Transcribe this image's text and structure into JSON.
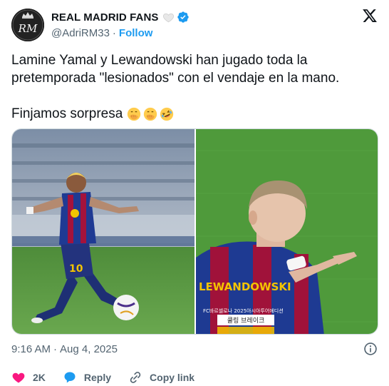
{
  "account": {
    "name": "REAL MADRID FANS",
    "handle": "@AdriRM33",
    "separator": "·",
    "follow_label": "Follow",
    "avatar_monogram": "RM",
    "icons": [
      "white-heart-icon",
      "verified-badge-icon"
    ]
  },
  "brand_icon": "x-logo-icon",
  "tweet": {
    "line1": "Lamine Yamal y Lewandowski han jugado toda la",
    "line2": "pretemporada \"lesionados\" con el vendaje en la mano.",
    "line3": "Finjamos sorpresa",
    "emojis": [
      "face-with-hand-over-mouth-icon",
      "face-with-hand-over-mouth-icon",
      "rolling-on-floor-laughing-icon"
    ]
  },
  "media": {
    "photos": [
      {
        "name": "photo-lamine-yamal",
        "jersey_number": "10"
      },
      {
        "name": "photo-lewandowski",
        "jersey_name": "LEWANDOWSKI",
        "caption_top": "FC바르셀로나 2025아시아투어에디션",
        "caption_bottom": "쿨링 브레이크"
      }
    ]
  },
  "meta": {
    "time": "9:16 AM",
    "separator": "·",
    "date": "Aug 4, 2025"
  },
  "actions": {
    "like_count": "2K",
    "reply_label": "Reply",
    "copy_link_label": "Copy link"
  },
  "colors": {
    "accent": "#1d9bf0",
    "text": "#0f1419",
    "muted": "#536471",
    "like": "#f91880",
    "border": "#cfd9de"
  }
}
